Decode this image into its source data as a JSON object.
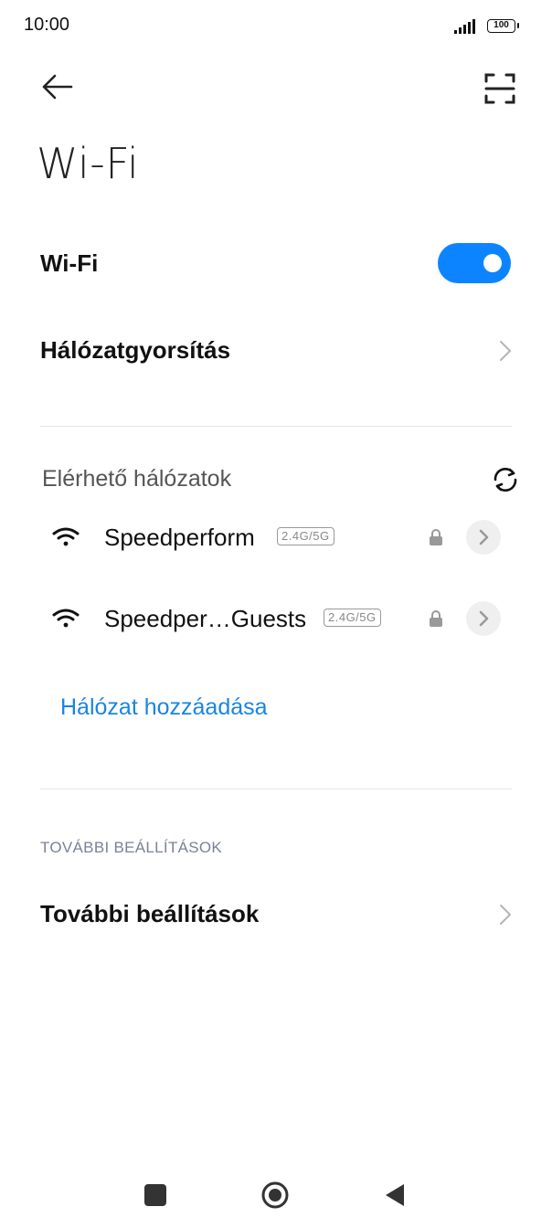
{
  "status_bar": {
    "time": "10:00",
    "battery": "100",
    "icons": [
      "signal-icon",
      "battery-icon"
    ]
  },
  "header": {
    "back_icon": "back-arrow-icon",
    "scan_icon": "qr-scan-icon",
    "title": "Wi-Fi"
  },
  "settings": {
    "wifi_label": "Wi-Fi",
    "wifi_enabled": true,
    "accel_label": "Hálózatgyorsítás"
  },
  "networks": {
    "section_title": "Elérhető hálózatok",
    "refresh_icon": "refresh-icon",
    "items": [
      {
        "name": "Speedperform",
        "band": "2.4G/5G",
        "secured": true
      },
      {
        "name": "Speedper…Guests",
        "band": "2.4G/5G",
        "secured": true
      }
    ],
    "add_label": "Hálózat hozzáadása"
  },
  "more": {
    "section_title": "TOVÁBBI BEÁLLÍTÁSOK",
    "item_label": "További beállítások"
  },
  "nav_bar": {
    "icons": [
      "recents-square-icon",
      "home-circle-icon",
      "back-triangle-icon"
    ]
  },
  "colors": {
    "accent": "#0d84ff",
    "link": "#1a84e4"
  }
}
